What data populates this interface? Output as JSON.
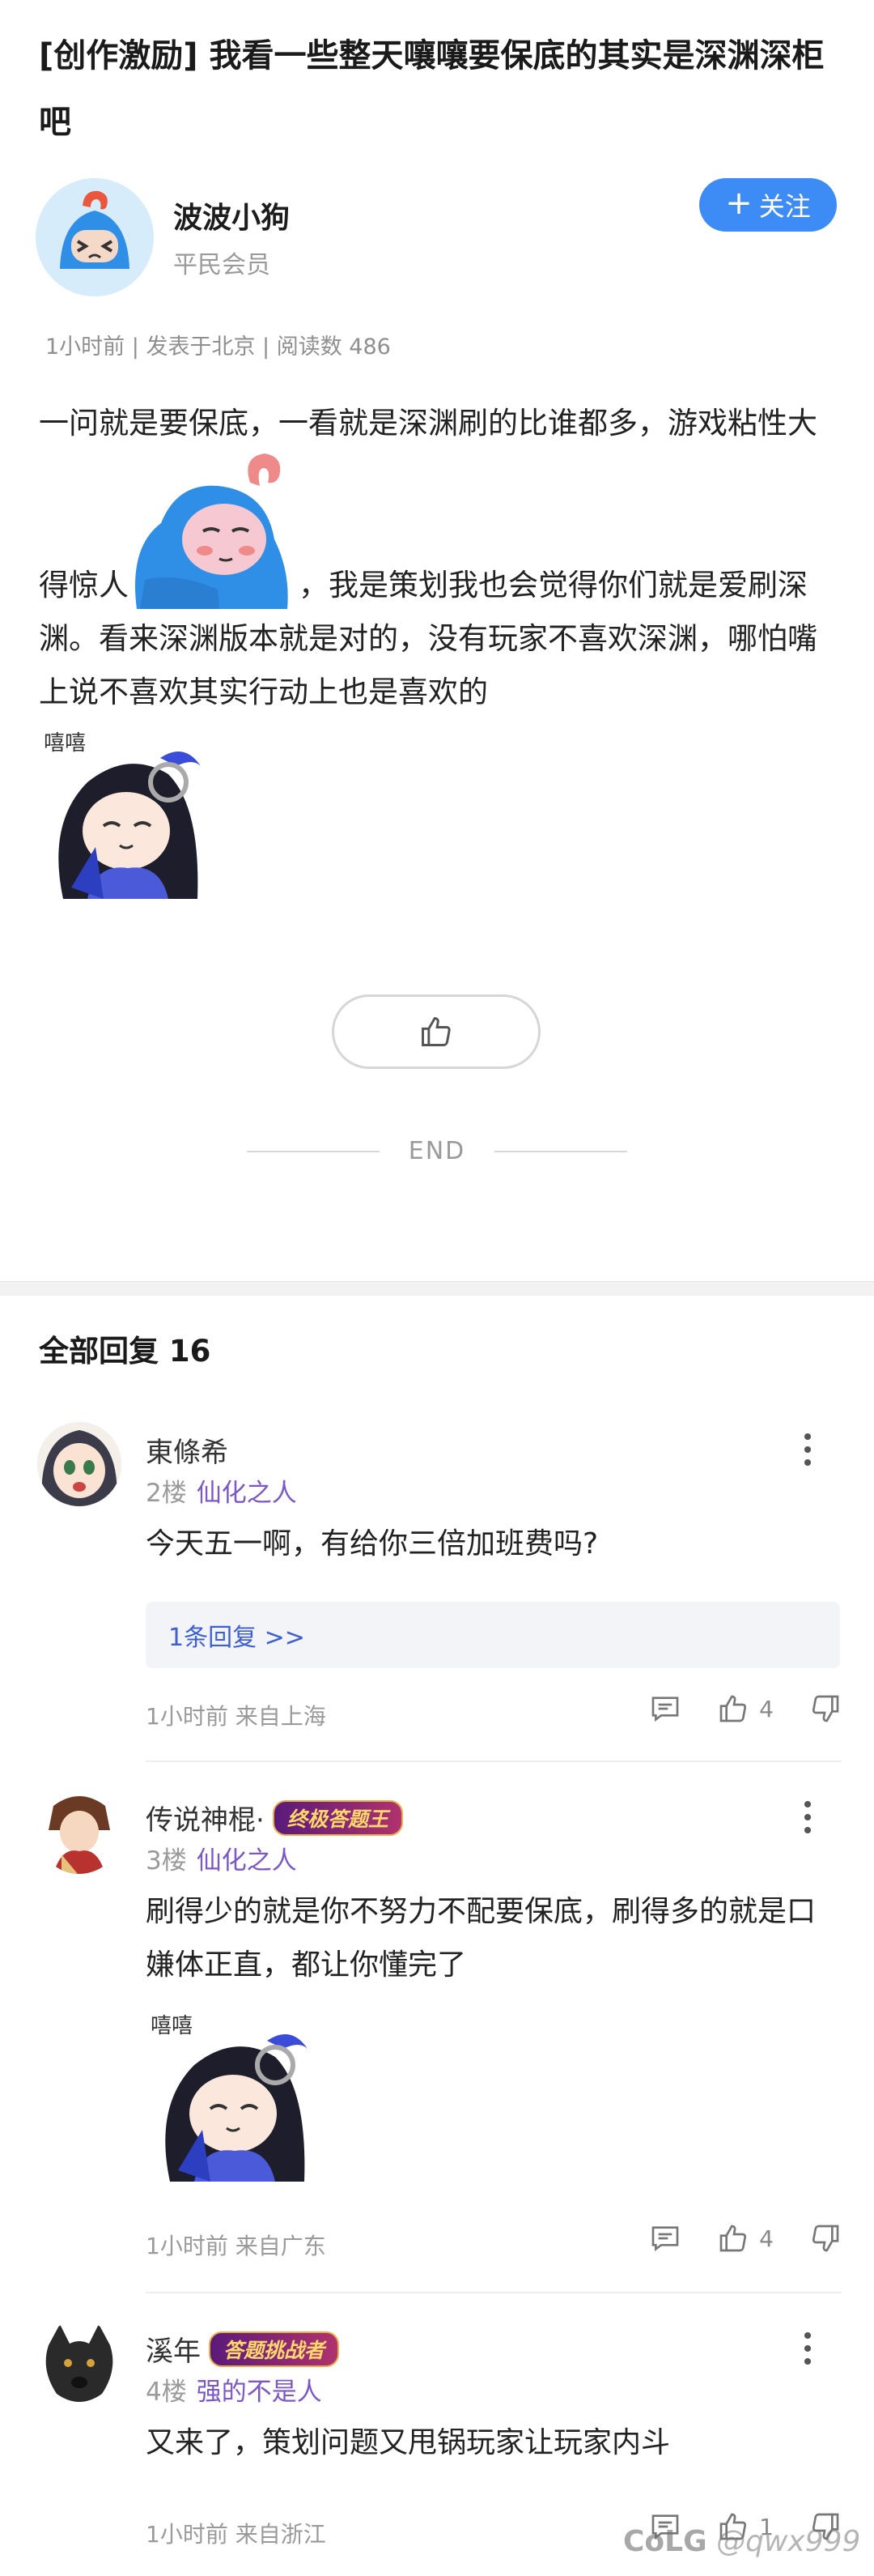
{
  "post": {
    "title": "[创作激励] 我看一些整天嚷嚷要保底的其实是深渊深柜吧",
    "author": {
      "name": "波波小狗",
      "rank": "平民会员"
    },
    "follow_label": "关注",
    "meta": "1小时前 | 发表于北京 | 阅读数 486",
    "body_part1": "一问就是要保底，一看就是深渊刷的比谁都多，游戏粘性大得惊人",
    "body_part2": "，我是策划我也会觉得你们就是爱刷深渊。看来深渊版本就是对的，没有玩家不喜欢深渊，哪怕嘴上说不喜欢其实行动上也是喜欢的",
    "sticker_caption": "嘻嘻",
    "end_label": "END"
  },
  "replies_header": {
    "label": "全部回复",
    "count": "16"
  },
  "replies": [
    {
      "name": "東條希",
      "floor": "2楼",
      "level": "仙化之人",
      "text": "今天五一啊，有给你三倍加班费吗?",
      "subreply": "1条回复 >>",
      "time": "1小时前 来自上海",
      "likes": "4"
    },
    {
      "name": "传说神棍·",
      "badge": "终极答题王",
      "floor": "3楼",
      "level": "仙化之人",
      "text": "刷得少的就是你不努力不配要保底，刷得多的就是口嫌体正直，都让你懂完了",
      "sticker_caption": "嘻嘻",
      "time": "1小时前 来自广东",
      "likes": "4"
    },
    {
      "name": "溪年",
      "badge": "答题挑战者",
      "floor": "4楼",
      "level": "强的不是人",
      "text": "又来了，策划问题又甩锅玩家让玩家内斗",
      "time": "1小时前 来自浙江",
      "likes": "1"
    }
  ],
  "watermark": {
    "logo": "CoLG",
    "user": "@qwx999"
  },
  "colors": {
    "accent": "#3d8cf5",
    "level": "#7b57c8",
    "link": "#3d5fd6"
  },
  "icons": [
    "plus-icon",
    "thumb-up-icon",
    "comment-icon",
    "thumb-down-icon",
    "more-icon"
  ]
}
